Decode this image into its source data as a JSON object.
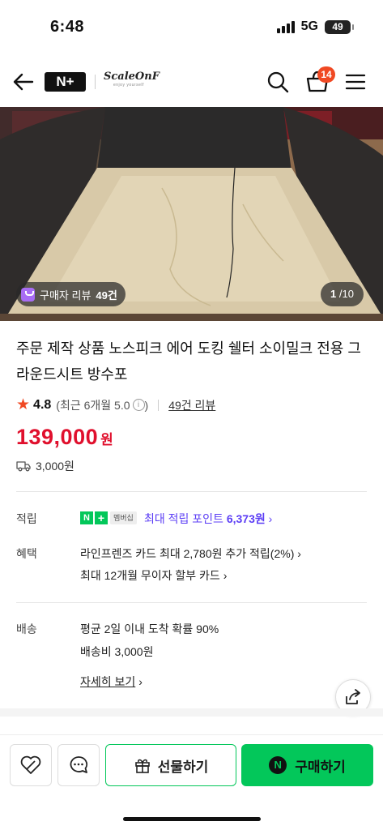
{
  "status_bar": {
    "time": "6:48",
    "network": "5G",
    "battery": "49"
  },
  "header": {
    "logo_text": "N+",
    "brand_name": "ScaleOnF",
    "brand_tagline": "enjoy yourself",
    "cart_count": "14"
  },
  "gallery": {
    "review_prefix": "구매자 리뷰",
    "review_count": "49건",
    "current_page": "1",
    "page_sep": "/",
    "total_pages": "10"
  },
  "product": {
    "title": "주문 제작 상품 노스피크 에어 도킹 쉘터 소이밀크 전용 그라운드시트 방수포",
    "rating": "4.8",
    "rating_recent": "(최근 6개월 5.0",
    "rating_close": ")",
    "review_link": "49건 리뷰",
    "price": "139,000",
    "price_unit": "원",
    "shipping_fee": "3,000원"
  },
  "benefits": {
    "points_label": "적립",
    "membership_badge": "멤버십",
    "points_prefix": "최대 적립 포인트",
    "points_value": "6,373원",
    "perks_label": "혜택",
    "perk_card": "라인프렌즈 카드 최대 2,780원 추가 적립(2%)",
    "perk_installment": "최대 12개월 무이자 할부 카드"
  },
  "delivery": {
    "label": "배송",
    "arrival": "평균 2일 이내 도착 확률 90%",
    "fee": "배송비 3,000원",
    "detail_link": "자세히 보기"
  },
  "bottom_bar": {
    "gift_label": "선물하기",
    "buy_label": "구매하기",
    "buy_badge": "N"
  },
  "colors": {
    "naver_green": "#03c75a",
    "price_red": "#e0102d",
    "point_purple": "#5b3df5",
    "badge_orange": "#f04923"
  },
  "icons": [
    "back-arrow-icon",
    "search-icon",
    "cart-icon",
    "menu-icon",
    "star-icon",
    "truck-icon",
    "share-icon",
    "like-icon",
    "chat-icon",
    "gift-icon"
  ]
}
